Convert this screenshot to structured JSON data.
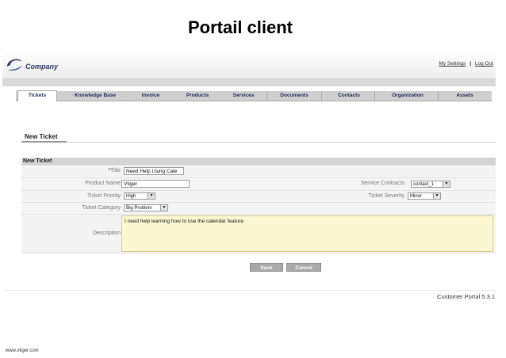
{
  "slide": {
    "title": "Portail client",
    "website": "www.vtiger.com"
  },
  "header": {
    "logo_text": "Company",
    "my_settings": "My Settings",
    "separator": "|",
    "logout": "Log Out"
  },
  "tabs": [
    "Tickets",
    "Knowledge Base",
    "Invoice",
    "Products",
    "Services",
    "Documents",
    "Contacts",
    "Organization",
    "Assets"
  ],
  "page": {
    "heading": "New Ticket",
    "section_label": "New Ticket"
  },
  "form": {
    "title_label": "Title",
    "title_required_mark": "*",
    "title_value": "Need Help Using Cale",
    "product_name_label": "Product Name",
    "product_name_value": "Vtiger",
    "service_contracts_label": "Service Contracts",
    "service_contracts_value": "contact_1",
    "ticket_priority_label": "Ticket Priority",
    "ticket_priority_value": "High",
    "ticket_severity_label": "Ticket Severity",
    "ticket_severity_value": "Minor",
    "ticket_category_label": "Ticket Category",
    "ticket_category_value": "Big Problem",
    "description_label": "Description",
    "description_value": "I need help learning how to use the calendar feature"
  },
  "buttons": {
    "save": "Save",
    "cancel": "Cancel"
  },
  "footer": {
    "version": "Customer Portal 5.3.1"
  },
  "colors": {
    "brand": "#2b3a66",
    "description_bg": "#fbf7d2"
  }
}
